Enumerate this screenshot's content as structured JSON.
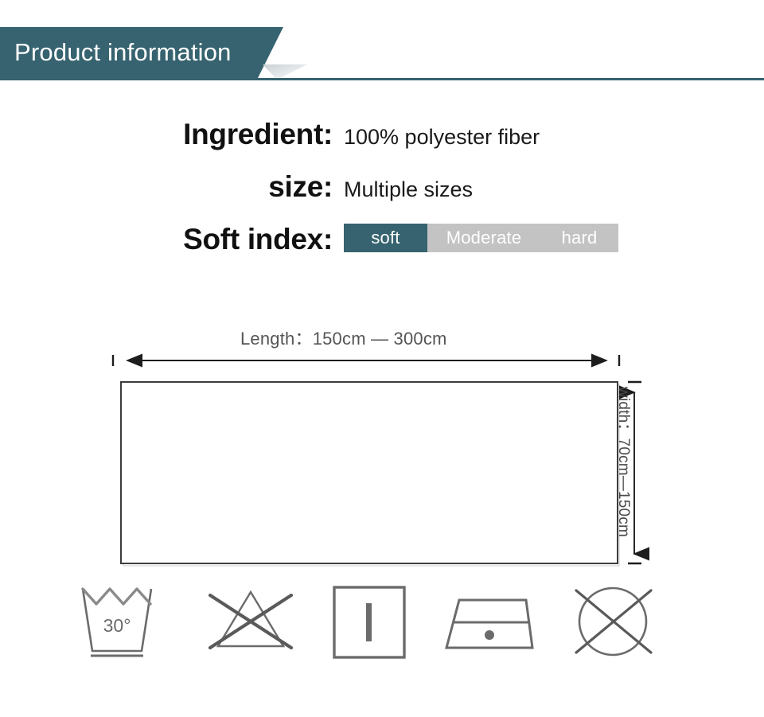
{
  "header": {
    "title": "Product information",
    "banner_color": "#36636f",
    "title_color": "#ffffff"
  },
  "specs": [
    {
      "label": "Ingredient:",
      "value": "100% polyester fiber"
    },
    {
      "label": "size:",
      "value": "Multiple sizes"
    },
    {
      "label": "Soft index:",
      "value": ""
    }
  ],
  "soft_index": {
    "label": "Soft index:",
    "options": [
      {
        "text": "soft",
        "selected": true,
        "color": "#36636f"
      },
      {
        "text": "Moderate",
        "selected": false,
        "color": "#c3c3c3"
      },
      {
        "text": "hard",
        "selected": false,
        "color": "#c3c3c3"
      }
    ],
    "selected_value": "soft"
  },
  "dimensions": {
    "length_label": "Length：150cm — 300cm",
    "length_min": "150cm",
    "length_max": "300cm",
    "width_label": "width：70cm—150cm",
    "width_min": "70cm",
    "width_max": "150cm"
  },
  "care_icons": [
    {
      "name": "wash-30-icon",
      "label": "30°",
      "meaning": "machine wash 30 degrees"
    },
    {
      "name": "do-not-bleach-icon",
      "label": "",
      "meaning": "do not bleach"
    },
    {
      "name": "drip-dry-icon",
      "label": "",
      "meaning": "line dry / drip dry"
    },
    {
      "name": "iron-low-icon",
      "label": "",
      "meaning": "iron low temperature"
    },
    {
      "name": "do-not-dry-clean-icon",
      "label": "",
      "meaning": "do not dry clean"
    }
  ],
  "colors": {
    "accent_teal": "#36636f",
    "inactive_gray": "#c3c3c3",
    "line_gray": "#6b6b6b",
    "text_dark": "#111111",
    "text_muted": "#555555"
  }
}
